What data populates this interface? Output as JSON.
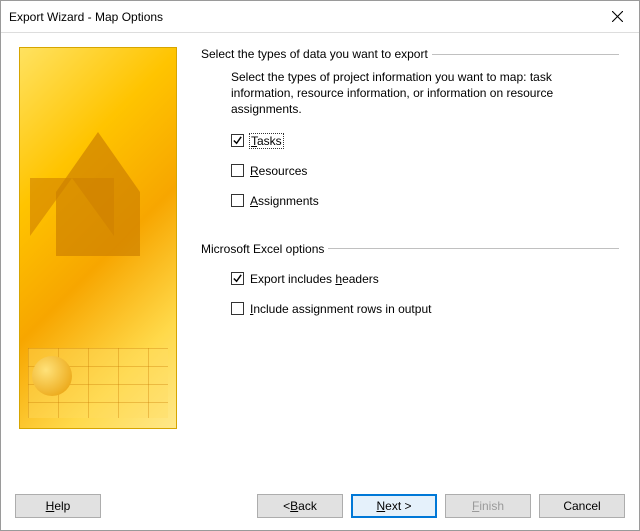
{
  "title": "Export Wizard - Map Options",
  "group1": {
    "legend": "Select the types of data you want to export",
    "help": "Select the types of project information you want to map: task information, resource information, or information on resource assignments.",
    "tasks": {
      "label_pre": "",
      "underline": "T",
      "label_post": "asks",
      "checked": true,
      "focused": true
    },
    "resources": {
      "label_pre": "",
      "underline": "R",
      "label_post": "esources",
      "checked": false
    },
    "assignments": {
      "label_pre": "",
      "underline": "A",
      "label_post": "ssignments",
      "checked": false
    }
  },
  "group2": {
    "legend": "Microsoft Excel options",
    "headers": {
      "label_pre": "Export includes ",
      "underline": "h",
      "label_post": "eaders",
      "checked": true
    },
    "includerows": {
      "label_pre": "",
      "underline": "I",
      "label_post": "nclude assignment rows in output",
      "checked": false
    }
  },
  "buttons": {
    "help": {
      "underline": "H",
      "post": "elp"
    },
    "back": {
      "pre": "< ",
      "underline": "B",
      "post": "ack"
    },
    "next": {
      "underline": "N",
      "post": "ext >"
    },
    "finish": {
      "underline": "F",
      "post": "inish"
    },
    "cancel": {
      "text": "Cancel"
    }
  }
}
